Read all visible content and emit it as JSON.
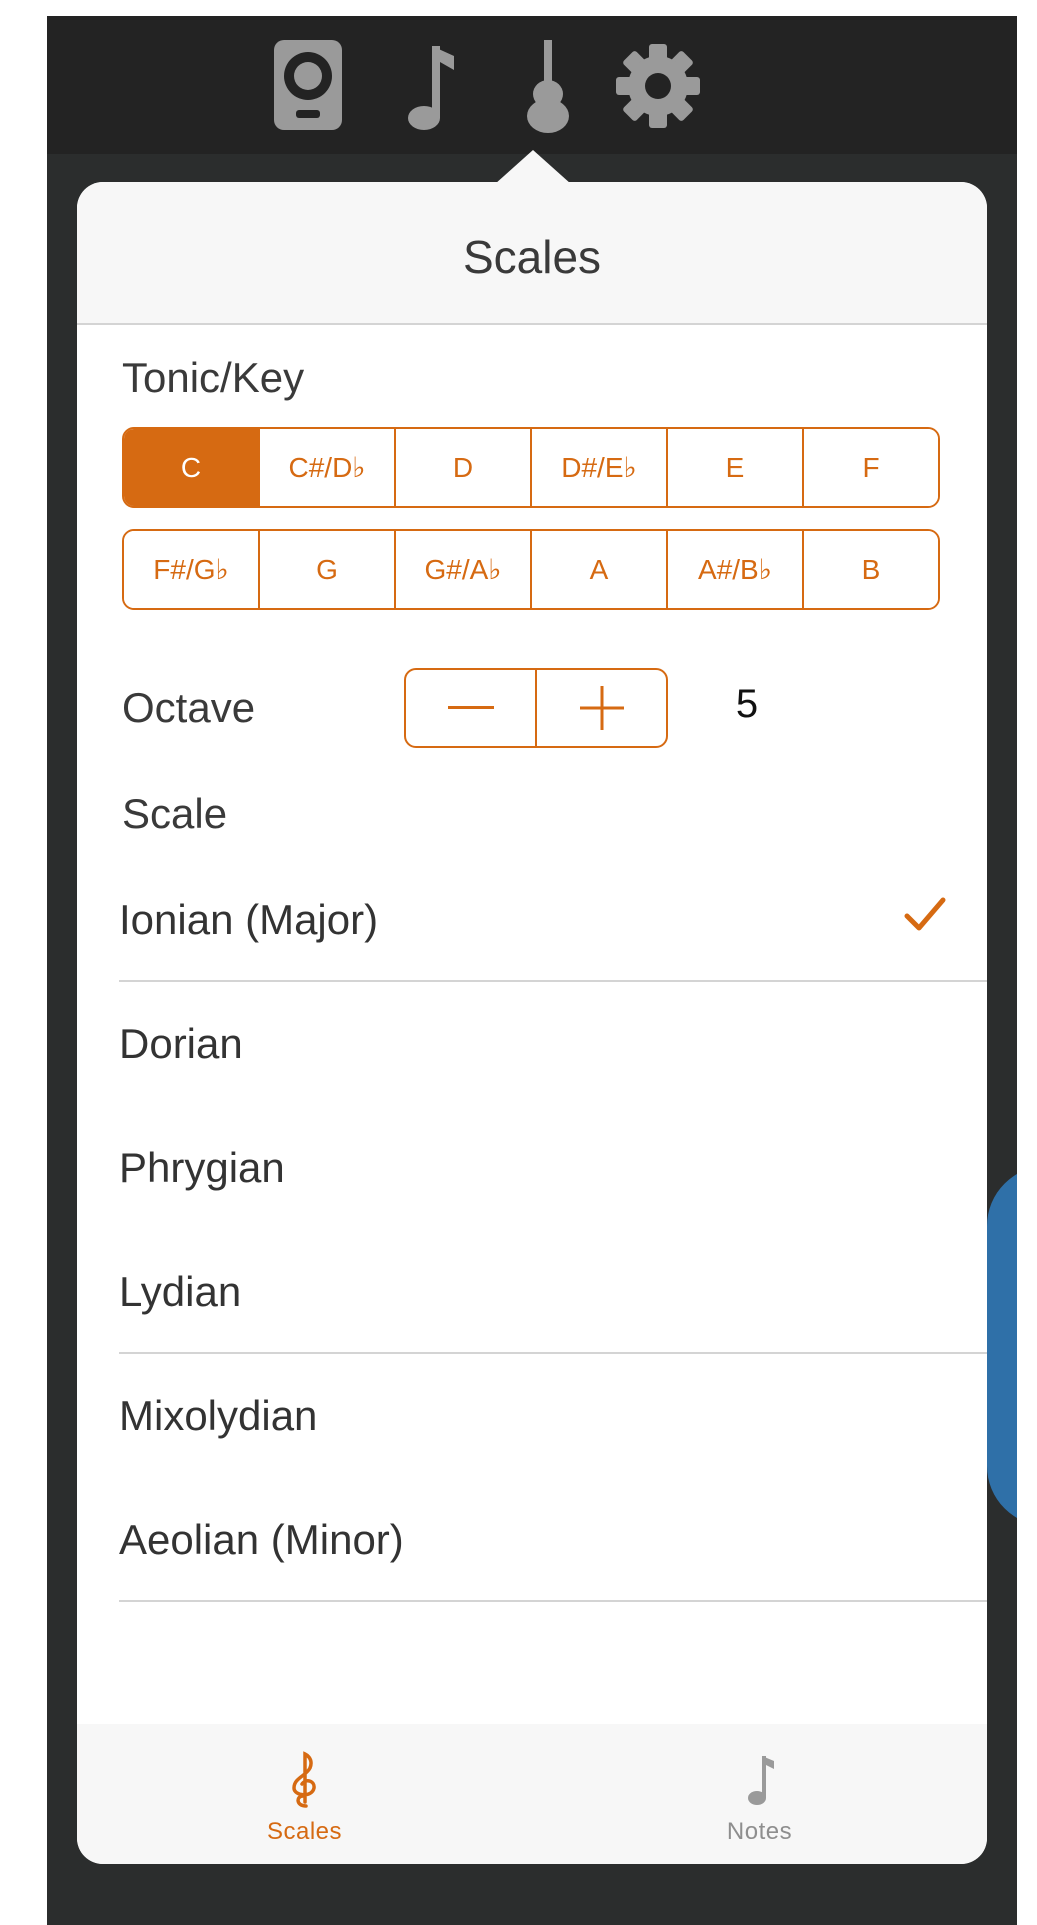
{
  "top_toolbar": {
    "icons": [
      "speaker-icon",
      "music-note-icon",
      "guitar-icon",
      "gear-icon"
    ]
  },
  "popover": {
    "title": "Scales",
    "tonic_label": "Tonic/Key",
    "keys_row1": [
      "C",
      "C#/D♭",
      "D",
      "D#/E♭",
      "E",
      "F"
    ],
    "keys_row2": [
      "F#/G♭",
      "G",
      "G#/A♭",
      "A",
      "A#/B♭",
      "B"
    ],
    "selected_key": "C",
    "octave_label": "Octave",
    "octave_decrement": "—",
    "octave_increment": "+",
    "octave_value": "5",
    "scale_label": "Scale",
    "scales": [
      "Ionian (Major)",
      "Dorian",
      "Phrygian",
      "Lydian",
      "Mixolydian",
      "Aeolian (Minor)"
    ],
    "selected_scale": "Ionian (Major)"
  },
  "tabbar": {
    "tabs": [
      {
        "label": "Scales",
        "icon": "treble-clef-icon",
        "active": true
      },
      {
        "label": "Notes",
        "icon": "music-note-icon",
        "active": false
      }
    ]
  },
  "colors": {
    "accent": "#d66a12",
    "toolbar_bg": "#232323",
    "backdrop": "#2b2d2d",
    "header_bg": "#f7f7f7",
    "toolbar_icon": "#9a9a9a"
  }
}
